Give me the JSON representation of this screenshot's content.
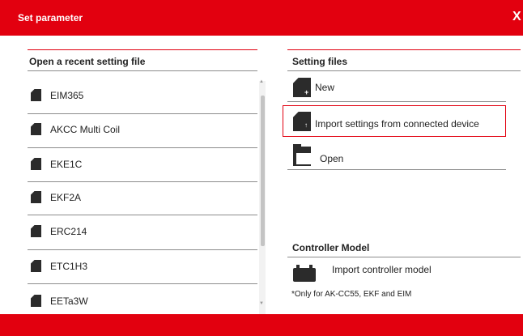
{
  "window": {
    "title": "Set parameter",
    "close_label": "X"
  },
  "recent": {
    "heading": "Open a recent setting file",
    "items": [
      "EIM365",
      "AKCC Multi Coil",
      "EKE1C",
      "EKF2A",
      "ERC214",
      "ETC1H3",
      "EETa3W"
    ]
  },
  "setting_files": {
    "heading": "Setting files",
    "new_label": "New",
    "import_label": "Import settings from connected device",
    "open_label": "Open"
  },
  "controller_model": {
    "heading": "Controller Model",
    "import_label": "Import controller model",
    "footnote": "*Only for AK-CC55, EKF and EIM"
  },
  "colors": {
    "accent": "#e2000f",
    "icon": "#2b2b2b",
    "divider": "#8c8c8c"
  }
}
